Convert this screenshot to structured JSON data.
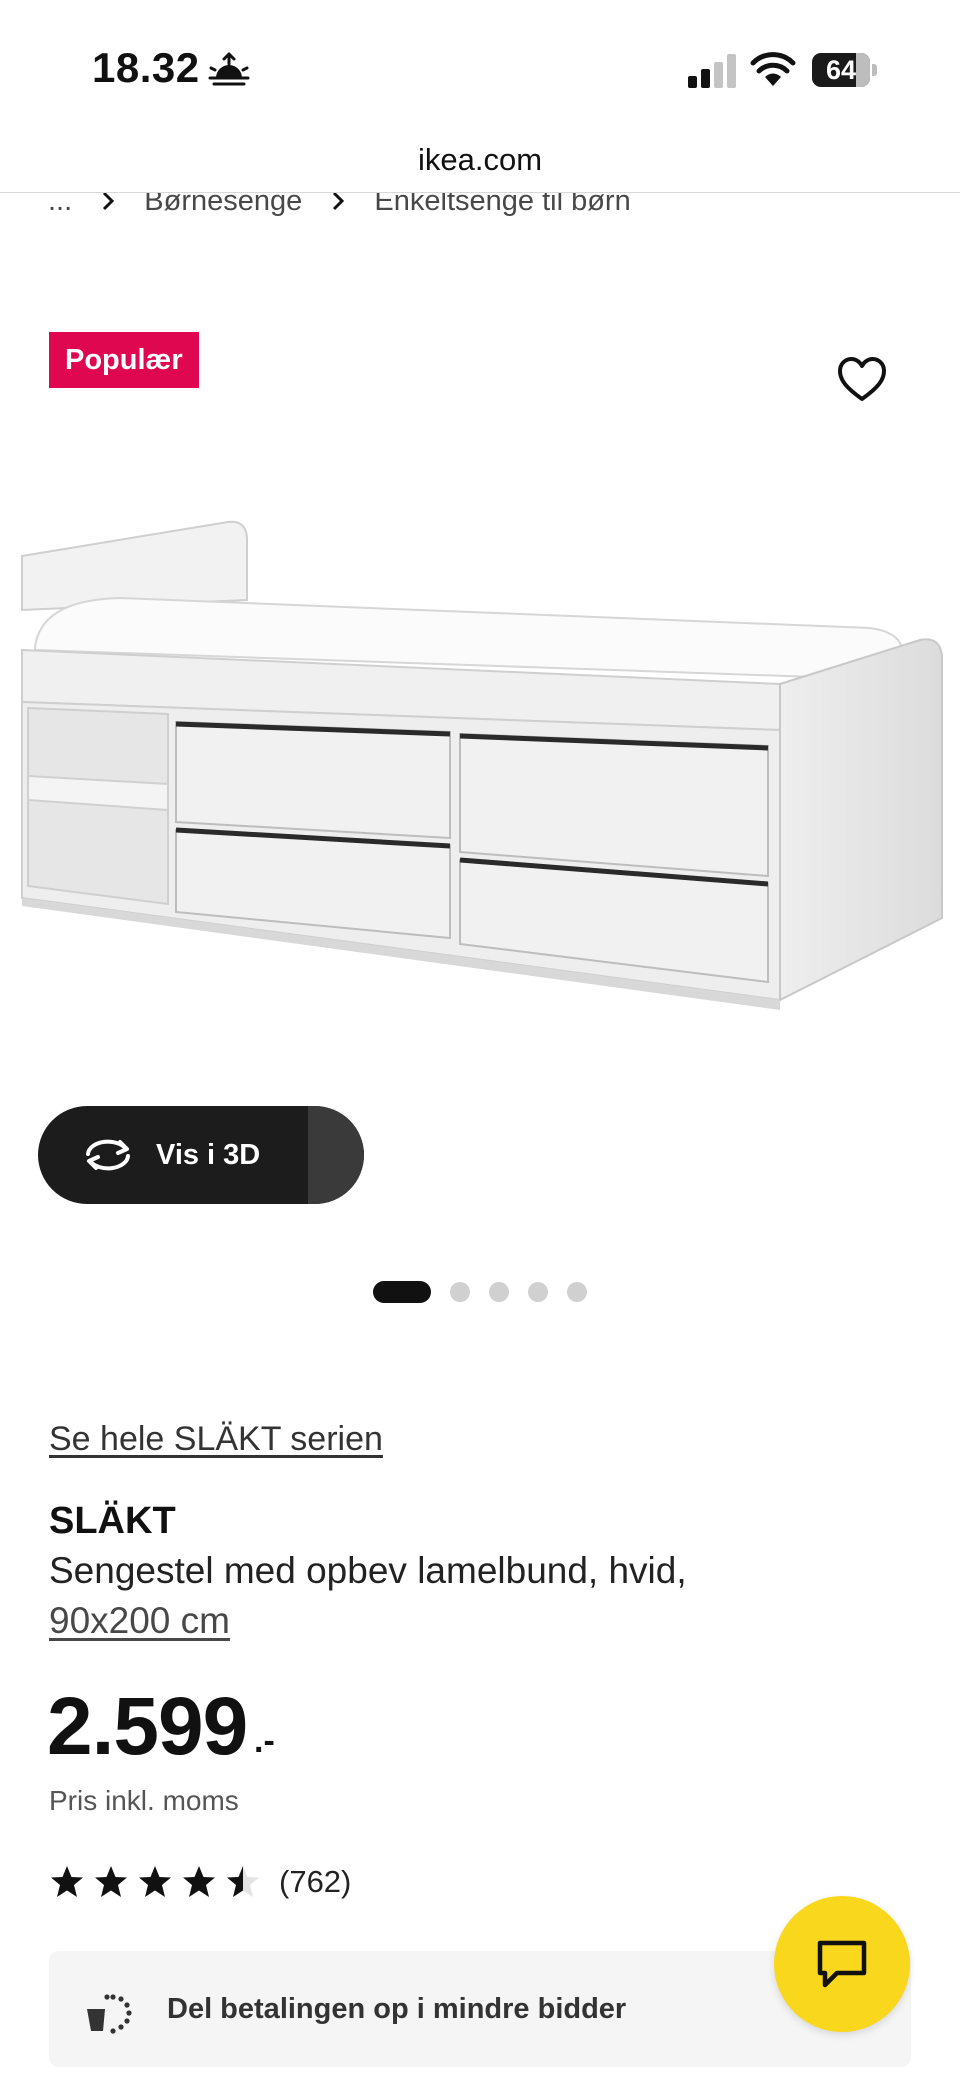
{
  "status_bar": {
    "time": "18.32",
    "battery_level": "64",
    "icons": [
      "sunrise-icon",
      "cellular-signal-icon",
      "wifi-icon",
      "battery-icon"
    ]
  },
  "browser": {
    "url": "ikea.com"
  },
  "breadcrumb": {
    "items": [
      "...",
      "Børnesenge",
      "Enkeltsenge til børn"
    ]
  },
  "product_media": {
    "badge": "Populær",
    "favorite_icon": "heart-icon",
    "view_3d_label": "Vis i 3D",
    "carousel": {
      "total": 5,
      "active_index": 0
    }
  },
  "product": {
    "series_link": "Se hele SLÄKT serien",
    "name": "SLÄKT",
    "description": "Sengestel med opbev lamelbund, hvid,",
    "size": "90x200 cm",
    "price": "2.599",
    "price_suffix": ".-",
    "price_note": "Pris inkl. moms",
    "rating": {
      "value": 4.5,
      "max": 5,
      "count_label": "(762)"
    }
  },
  "payment": {
    "label": "Del betalingen op i mindre bidder"
  },
  "chat": {
    "icon": "chat-bubble-icon"
  },
  "colors": {
    "badge": "#e00751",
    "chat_button": "#f9d71c",
    "text": "#111111"
  }
}
